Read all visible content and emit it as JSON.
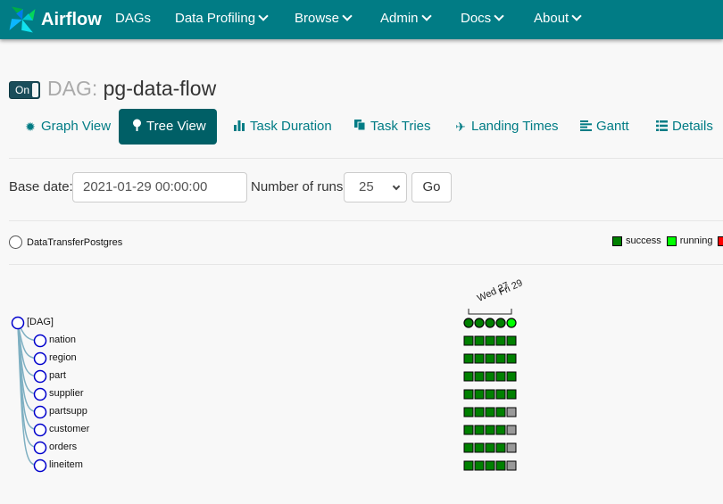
{
  "navbar": {
    "brand": "Airflow",
    "items": [
      {
        "label": "DAGs",
        "dropdown": false
      },
      {
        "label": "Data Profiling",
        "dropdown": true
      },
      {
        "label": "Browse",
        "dropdown": true
      },
      {
        "label": "Admin",
        "dropdown": true
      },
      {
        "label": "Docs",
        "dropdown": true
      },
      {
        "label": "About",
        "dropdown": true
      }
    ],
    "color": "#017c85"
  },
  "dag": {
    "toggle_label": "On",
    "prefix": "DAG:",
    "name": "pg-data-flow"
  },
  "tabs": [
    {
      "label": "Graph View",
      "icon": "asterisk-icon",
      "active": false
    },
    {
      "label": "Tree View",
      "icon": "tree-icon",
      "active": true
    },
    {
      "label": "Task Duration",
      "icon": "bar-chart-icon",
      "active": false
    },
    {
      "label": "Task Tries",
      "icon": "duplicate-icon",
      "active": false
    },
    {
      "label": "Landing Times",
      "icon": "plane-icon",
      "active": false
    },
    {
      "label": "Gantt",
      "icon": "align-left-icon",
      "active": false
    },
    {
      "label": "Details",
      "icon": "list-icon",
      "active": false
    }
  ],
  "form": {
    "base_date_label": "Base date:",
    "base_date_value": "2021-01-29 00:00:00",
    "num_runs_label": "Number of runs:",
    "num_runs_value": "25",
    "go_label": "Go"
  },
  "operator_legend": {
    "label": "DataTransferPostgres"
  },
  "state_legend": [
    {
      "label": "success",
      "color": "#008000"
    },
    {
      "label": "running",
      "color": "#00ff00"
    },
    {
      "label": "",
      "color": "#ff0000"
    }
  ],
  "tree": {
    "dates": [
      "Wed 27",
      "Fri 29"
    ],
    "root": {
      "label": "[DAG]",
      "states": [
        "success",
        "success",
        "success",
        "success",
        "running"
      ]
    },
    "tasks": [
      {
        "label": "nation",
        "states": [
          "success",
          "success",
          "success",
          "success",
          "success"
        ]
      },
      {
        "label": "region",
        "states": [
          "success",
          "success",
          "success",
          "success",
          "success"
        ]
      },
      {
        "label": "part",
        "states": [
          "success",
          "success",
          "success",
          "success",
          "success"
        ]
      },
      {
        "label": "supplier",
        "states": [
          "success",
          "success",
          "success",
          "success",
          "success"
        ]
      },
      {
        "label": "partsupp",
        "states": [
          "success",
          "success",
          "success",
          "success",
          "none"
        ]
      },
      {
        "label": "customer",
        "states": [
          "success",
          "success",
          "success",
          "success",
          "none"
        ]
      },
      {
        "label": "orders",
        "states": [
          "success",
          "success",
          "success",
          "success",
          "none"
        ]
      },
      {
        "label": "lineitem",
        "states": [
          "success",
          "success",
          "success",
          "success",
          "none"
        ]
      }
    ],
    "state_colors": {
      "success": "#008000",
      "running": "#00ff00",
      "none": "#999999"
    }
  }
}
